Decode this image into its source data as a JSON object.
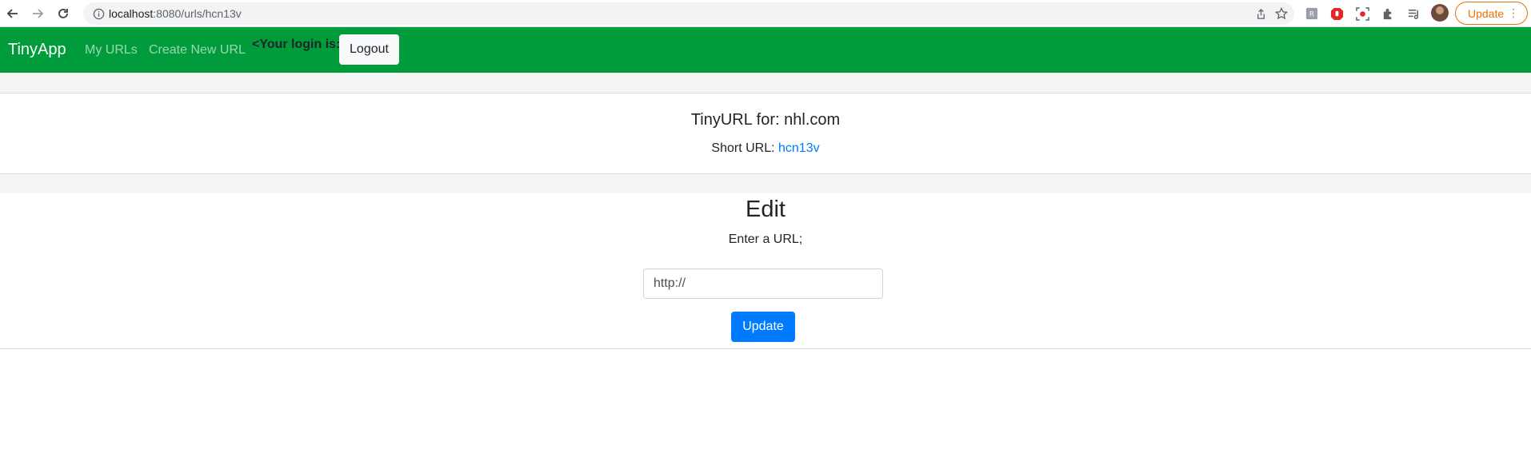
{
  "browser": {
    "url_host": "localhost",
    "url_rest": ":8080/urls/hcn13v",
    "update_label": "Update",
    "icons": [
      "back-icon",
      "forward-icon",
      "reload-icon",
      "info-icon",
      "share-icon",
      "star-icon",
      "extension-icons",
      "profile-avatar",
      "kebab-icon"
    ]
  },
  "navbar": {
    "brand": "TinyApp",
    "links": [
      "My URLs",
      "Create New URL"
    ],
    "login_text": "<Your login is:",
    "logout_label": "Logout",
    "color": "#009c3b"
  },
  "card": {
    "title": "TinyURL for: nhl.com",
    "short_url_label": "Short URL:",
    "short_url_value": "hcn13v"
  },
  "edit": {
    "title": "Edit",
    "label": "Enter a URL;",
    "input_placeholder": "http://",
    "button_label": "Update",
    "button_color": "#007bff"
  }
}
